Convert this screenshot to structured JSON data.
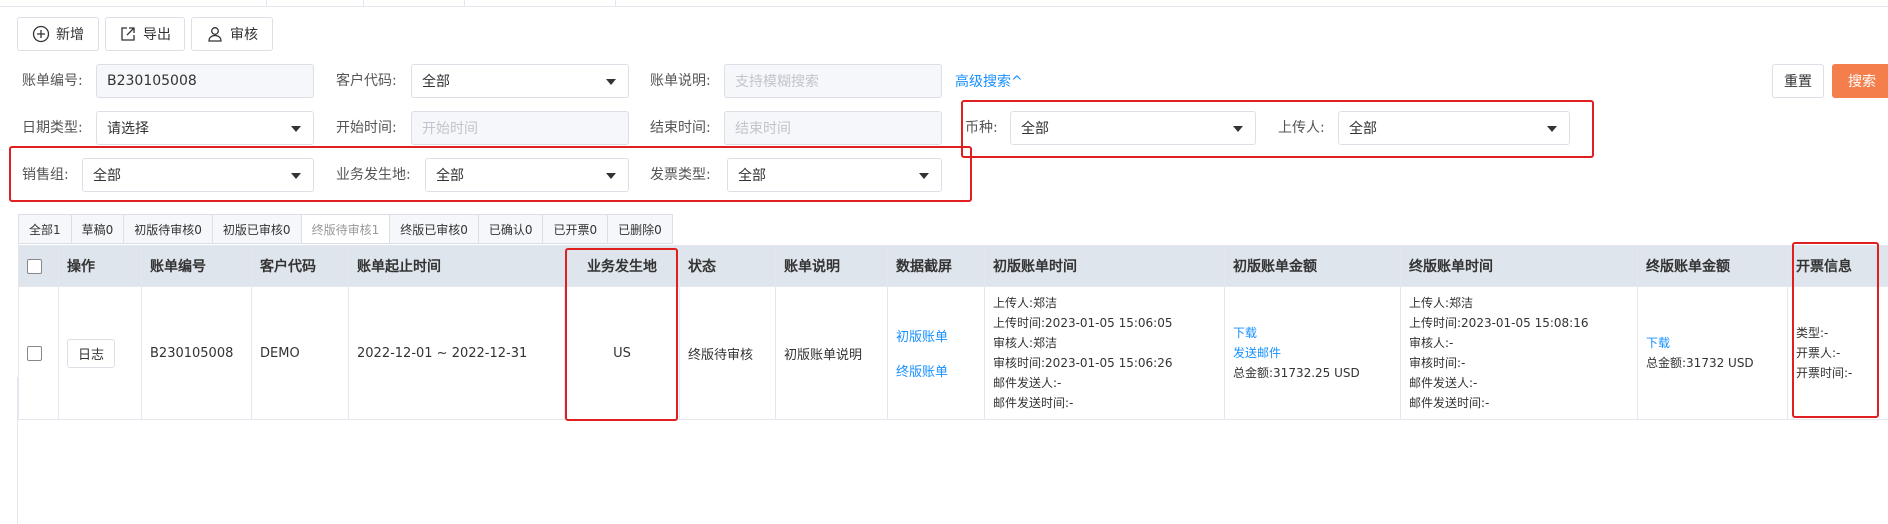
{
  "toolbar": {
    "add_label": "新增",
    "export_label": "导出",
    "audit_label": "审核"
  },
  "filters": {
    "bill_no_label": "账单编号:",
    "bill_no_value": "B230105008",
    "customer_code_label": "客户代码:",
    "customer_code_value": "全部",
    "bill_desc_label": "账单说明:",
    "bill_desc_placeholder": "支持模糊搜索",
    "advanced_search": "高级搜索^",
    "date_type_label": "日期类型:",
    "date_type_value": "请选择",
    "start_time_label": "开始时间:",
    "start_time_placeholder": "开始时间",
    "end_time_label": "结束时间:",
    "end_time_placeholder": "结束时间",
    "currency_label": "币种:",
    "currency_value": "全部",
    "uploader_label": "上传人:",
    "uploader_value": "全部",
    "sales_group_label": "销售组:",
    "sales_group_value": "全部",
    "business_location_label": "业务发生地:",
    "business_location_value": "全部",
    "invoice_type_label": "发票类型:",
    "invoice_type_value": "全部",
    "reset_label": "重置",
    "search_label": "搜索"
  },
  "status_tabs": [
    "全部1",
    "草稿0",
    "初版待审核0",
    "初版已审核0",
    "终版待审核1",
    "终版已审核0",
    "已确认0",
    "已开票0",
    "已删除0"
  ],
  "table": {
    "headers": [
      "操作",
      "账单编号",
      "客户代码",
      "账单起止时间",
      "业务发生地",
      "状态",
      "账单说明",
      "数据截屏",
      "初版账单时间",
      "初版账单金额",
      "终版账单时间",
      "终版账单金额",
      "开票信息"
    ],
    "row": {
      "action": "日志",
      "bill_no": "B230105008",
      "customer_code": "DEMO",
      "period": "2022-12-01 ~ 2022-12-31",
      "location": "US",
      "status": "终版待审核",
      "desc": "初版账单说明",
      "screenshot_first": "初版账单",
      "screenshot_final": "终版账单",
      "first_time": [
        "上传人:郑洁",
        "上传时间:2023-01-05 15:06:05",
        "审核人:郑洁",
        "审核时间:2023-01-05 15:06:26",
        "邮件发送人:-",
        "邮件发送时间:-"
      ],
      "first_amount_download": "下载",
      "first_amount_send": "发送邮件",
      "first_amount_total": "总金额:31732.25 USD",
      "final_time": [
        "上传人:郑洁",
        "上传时间:2023-01-05 15:08:16",
        "审核人:-",
        "审核时间:-",
        "邮件发送人:-",
        "邮件发送时间:-"
      ],
      "final_amount_download": "下载",
      "final_amount_total": "总金额:31732 USD",
      "invoice": [
        "类型:-",
        "开票人:-",
        "开票时间:-"
      ]
    }
  }
}
